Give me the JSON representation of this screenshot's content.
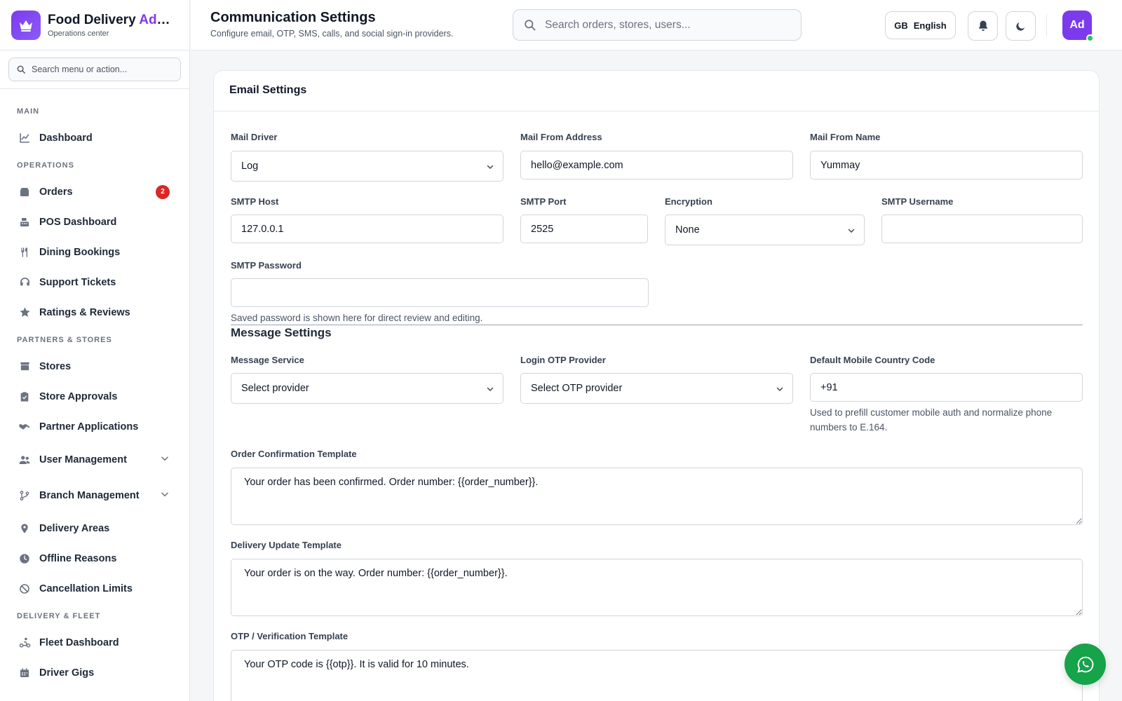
{
  "brand": {
    "title_main": "Food Delivery ",
    "title_accent": "Admin",
    "subtitle": "Operations center"
  },
  "sidebar": {
    "search_placeholder": "Search menu or action...",
    "sections": {
      "main": "MAIN",
      "operations": "OPERATIONS",
      "partners": "PARTNERS & STORES",
      "fleet": "DELIVERY & FLEET"
    },
    "items": {
      "dashboard": "Dashboard",
      "orders": "Orders",
      "orders_badge": "2",
      "pos": "POS Dashboard",
      "dining": "Dining Bookings",
      "support": "Support Tickets",
      "ratings": "Ratings & Reviews",
      "stores": "Stores",
      "approvals": "Store Approvals",
      "partner_apps": "Partner Applications",
      "user_mgmt": "User Management",
      "branch_mgmt": "Branch Management",
      "delivery_areas": "Delivery Areas",
      "offline": "Offline Reasons",
      "cancellation": "Cancellation Limits",
      "fleet": "Fleet Dashboard",
      "gigs": "Driver Gigs"
    }
  },
  "header": {
    "title": "Communication Settings",
    "subtitle": "Configure email, OTP, SMS, calls, and social sign-in providers.",
    "search_placeholder": "Search orders, stores, users...",
    "lang_code": "GB",
    "lang_label": "English",
    "avatar": "Ad"
  },
  "email": {
    "title": "Email Settings",
    "mail_driver_label": "Mail Driver",
    "mail_driver_value": "Log",
    "from_address_label": "Mail From Address",
    "from_address_value": "hello@example.com",
    "from_name_label": "Mail From Name",
    "from_name_value": "Yummay",
    "smtp_host_label": "SMTP Host",
    "smtp_host_value": "127.0.0.1",
    "smtp_port_label": "SMTP Port",
    "smtp_port_value": "2525",
    "encryption_label": "Encryption",
    "encryption_value": "None",
    "smtp_user_label": "SMTP Username",
    "smtp_user_value": "",
    "smtp_pass_label": "SMTP Password",
    "smtp_pass_value": "",
    "smtp_pass_hint": "Saved password is shown here for direct review and editing."
  },
  "message": {
    "title": "Message Settings",
    "service_label": "Message Service",
    "service_value": "Select provider",
    "otp_label": "Login OTP Provider",
    "otp_value": "Select OTP provider",
    "country_label": "Default Mobile Country Code",
    "country_value": "+91",
    "country_hint": "Used to prefill customer mobile auth and normalize phone numbers to E.164.",
    "order_tpl_label": "Order Confirmation Template",
    "order_tpl_value": "Your order has been confirmed. Order number: {{order_number}}.",
    "delivery_tpl_label": "Delivery Update Template",
    "delivery_tpl_value": "Your order is on the way. Order number: {{order_number}}.",
    "otp_tpl_label": "OTP / Verification Template",
    "otp_tpl_value": "Your OTP code is {{otp}}. It is valid for 10 minutes."
  },
  "colors": {
    "accent": "#7c3aed",
    "badge": "#dc2626",
    "whatsapp": "#16a34a"
  }
}
